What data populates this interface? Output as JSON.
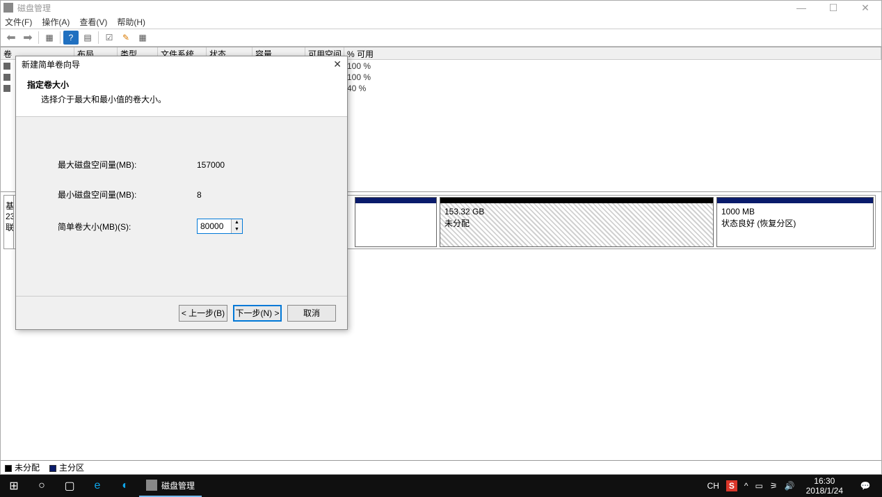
{
  "window": {
    "title": "磁盘管理",
    "minimize": "—",
    "maximize": "☐",
    "close": "✕"
  },
  "menu": {
    "file": "文件(F)",
    "action": "操作(A)",
    "view": "查看(V)",
    "help": "帮助(H)"
  },
  "table": {
    "headers": {
      "volume": "卷",
      "layout": "布局",
      "type": "类型",
      "filesystem": "文件系统",
      "status": "状态",
      "capacity": "容量",
      "free": "可用空间",
      "pct": "% 可用"
    }
  },
  "bg_rows": {
    "r1": "100 %",
    "r2": "100 %",
    "r3": "40 %"
  },
  "disk": {
    "label_left1": "基",
    "label_left2": "23",
    "label_left3": "联",
    "part2_size": "153.32 GB",
    "part2_status": "未分配",
    "part3_size": "1000 MB",
    "part3_status": "状态良好 (恢复分区)"
  },
  "legend": {
    "unalloc": "未分配",
    "primary": "主分区"
  },
  "wizard": {
    "title": "新建简单卷向导",
    "header_title": "指定卷大小",
    "header_sub": "选择介于最大和最小值的卷大小。",
    "max_label": "最大磁盘空间量(MB):",
    "max_value": "157000",
    "min_label": "最小磁盘空间量(MB):",
    "min_value": "8",
    "size_label": "简单卷大小(MB)(S):",
    "size_value": "80000",
    "back": "< 上一步(B)",
    "next": "下一步(N) >",
    "cancel": "取消"
  },
  "taskbar": {
    "app_label": "磁盘管理",
    "ime": "CH",
    "time": "16:30",
    "date": "2018/1/24"
  }
}
